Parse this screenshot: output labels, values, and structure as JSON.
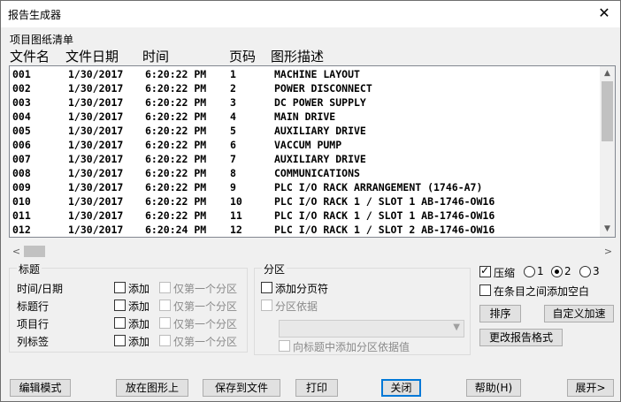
{
  "window": {
    "title": "报告生成器",
    "close_glyph": "✕"
  },
  "list": {
    "caption": "项目图纸清单",
    "columns": [
      "文件名",
      "文件日期",
      "时间",
      "页码",
      "图形描述"
    ],
    "rows": [
      [
        "001",
        "1/30/2017",
        "6:20:22 PM",
        "1",
        "MACHINE LAYOUT"
      ],
      [
        "002",
        "1/30/2017",
        "6:20:22 PM",
        "2",
        "POWER DISCONNECT"
      ],
      [
        "003",
        "1/30/2017",
        "6:20:22 PM",
        "3",
        "DC POWER SUPPLY"
      ],
      [
        "004",
        "1/30/2017",
        "6:20:22 PM",
        "4",
        "MAIN DRIVE"
      ],
      [
        "005",
        "1/30/2017",
        "6:20:22 PM",
        "5",
        "AUXILIARY DRIVE"
      ],
      [
        "006",
        "1/30/2017",
        "6:20:22 PM",
        "6",
        "VACCUM PUMP"
      ],
      [
        "007",
        "1/30/2017",
        "6:20:22 PM",
        "7",
        "AUXILIARY DRIVE"
      ],
      [
        "008",
        "1/30/2017",
        "6:20:22 PM",
        "8",
        "COMMUNICATIONS"
      ],
      [
        "009",
        "1/30/2017",
        "6:20:22 PM",
        "9",
        "PLC I/O RACK ARRANGEMENT (1746-A7)"
      ],
      [
        "010",
        "1/30/2017",
        "6:20:22 PM",
        "10",
        "PLC I/O RACK 1 / SLOT 1  AB-1746-OW16"
      ],
      [
        "011",
        "1/30/2017",
        "6:20:22 PM",
        "11",
        "PLC I/O RACK 1 / SLOT 1  AB-1746-OW16"
      ],
      [
        "012",
        "1/30/2017",
        "6:20:24 PM",
        "12",
        "PLC I/O RACK 1 / SLOT 2  AB-1746-OW16"
      ]
    ],
    "vscroll_up": "▲",
    "vscroll_down": "▼",
    "hscroll_left": "<",
    "hscroll_right": ">"
  },
  "title_group": {
    "label": "标题",
    "rows": [
      {
        "name": "时间/日期",
        "add": "添加",
        "first_only": "仅第一个分区"
      },
      {
        "name": "标题行",
        "add": "添加",
        "first_only": "仅第一个分区"
      },
      {
        "name": "项目行",
        "add": "添加",
        "first_only": "仅第一个分区"
      },
      {
        "name": "列标签",
        "add": "添加",
        "first_only": "仅第一个分区"
      }
    ]
  },
  "partition_group": {
    "label": "分区",
    "add_page_break": "添加分页符",
    "partition_by": "分区依据",
    "combo_value": "",
    "add_partition_value": "向标题中添加分区依据值"
  },
  "options": {
    "compress": "压缩",
    "compress_checked": true,
    "radios": [
      "1",
      "2",
      "3"
    ],
    "radio_selected": "2",
    "blank_between": "在条目之间添加空白",
    "sort": "排序",
    "custom_accel": "自定义加速",
    "change_format": "更改报告格式"
  },
  "buttons": {
    "edit_mode": "编辑模式",
    "place_in_drawing": "放在图形上",
    "save_to_file": "保存到文件",
    "print": "打印",
    "close": "关闭",
    "help": "帮助(H)",
    "expand": "展开>"
  }
}
